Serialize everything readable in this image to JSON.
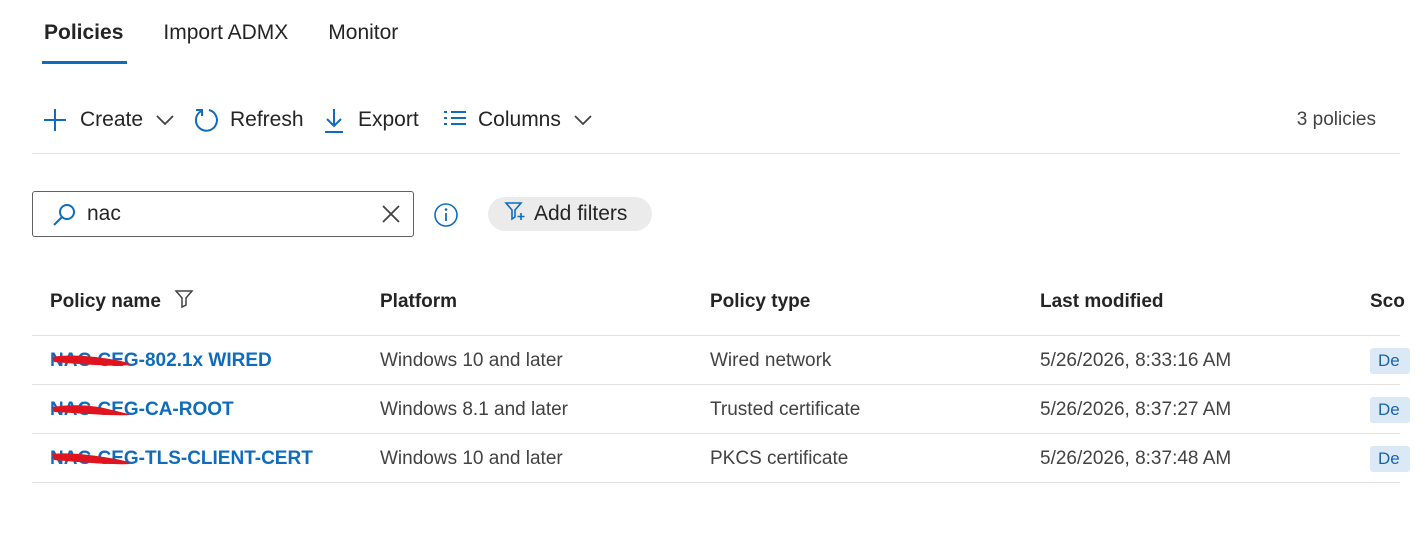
{
  "tabs": [
    {
      "label": "Policies",
      "active": true
    },
    {
      "label": "Import ADMX",
      "active": false
    },
    {
      "label": "Monitor",
      "active": false
    }
  ],
  "toolbar": {
    "create_label": "Create",
    "refresh_label": "Refresh",
    "export_label": "Export",
    "columns_label": "Columns",
    "count_label": "3 policies"
  },
  "search": {
    "value": "nac"
  },
  "filters": {
    "add_label": "Add filters"
  },
  "table": {
    "headers": [
      "Policy name",
      "Platform",
      "Policy type",
      "Last modified",
      "Sco"
    ],
    "rows": [
      {
        "name": "NAC-CEG-802.1x WIRED",
        "platform": "Windows 10 and later",
        "type": "Wired network",
        "modified": "5/26/2026, 8:33:16 AM",
        "scope": "De"
      },
      {
        "name": "NAC-CEG-CA-ROOT",
        "platform": "Windows 8.1 and later",
        "type": "Trusted certificate",
        "modified": "5/26/2026, 8:37:27 AM",
        "scope": "De"
      },
      {
        "name": "NAC-CEG-TLS-CLIENT-CERT",
        "platform": "Windows 10 and later",
        "type": "PKCS certificate",
        "modified": "5/26/2026, 8:37:48 AM",
        "scope": "De"
      }
    ]
  },
  "colors": {
    "accent": "#0f6cbd",
    "redaction": "#e0141e",
    "scope_badge": "#dbe9f7"
  }
}
